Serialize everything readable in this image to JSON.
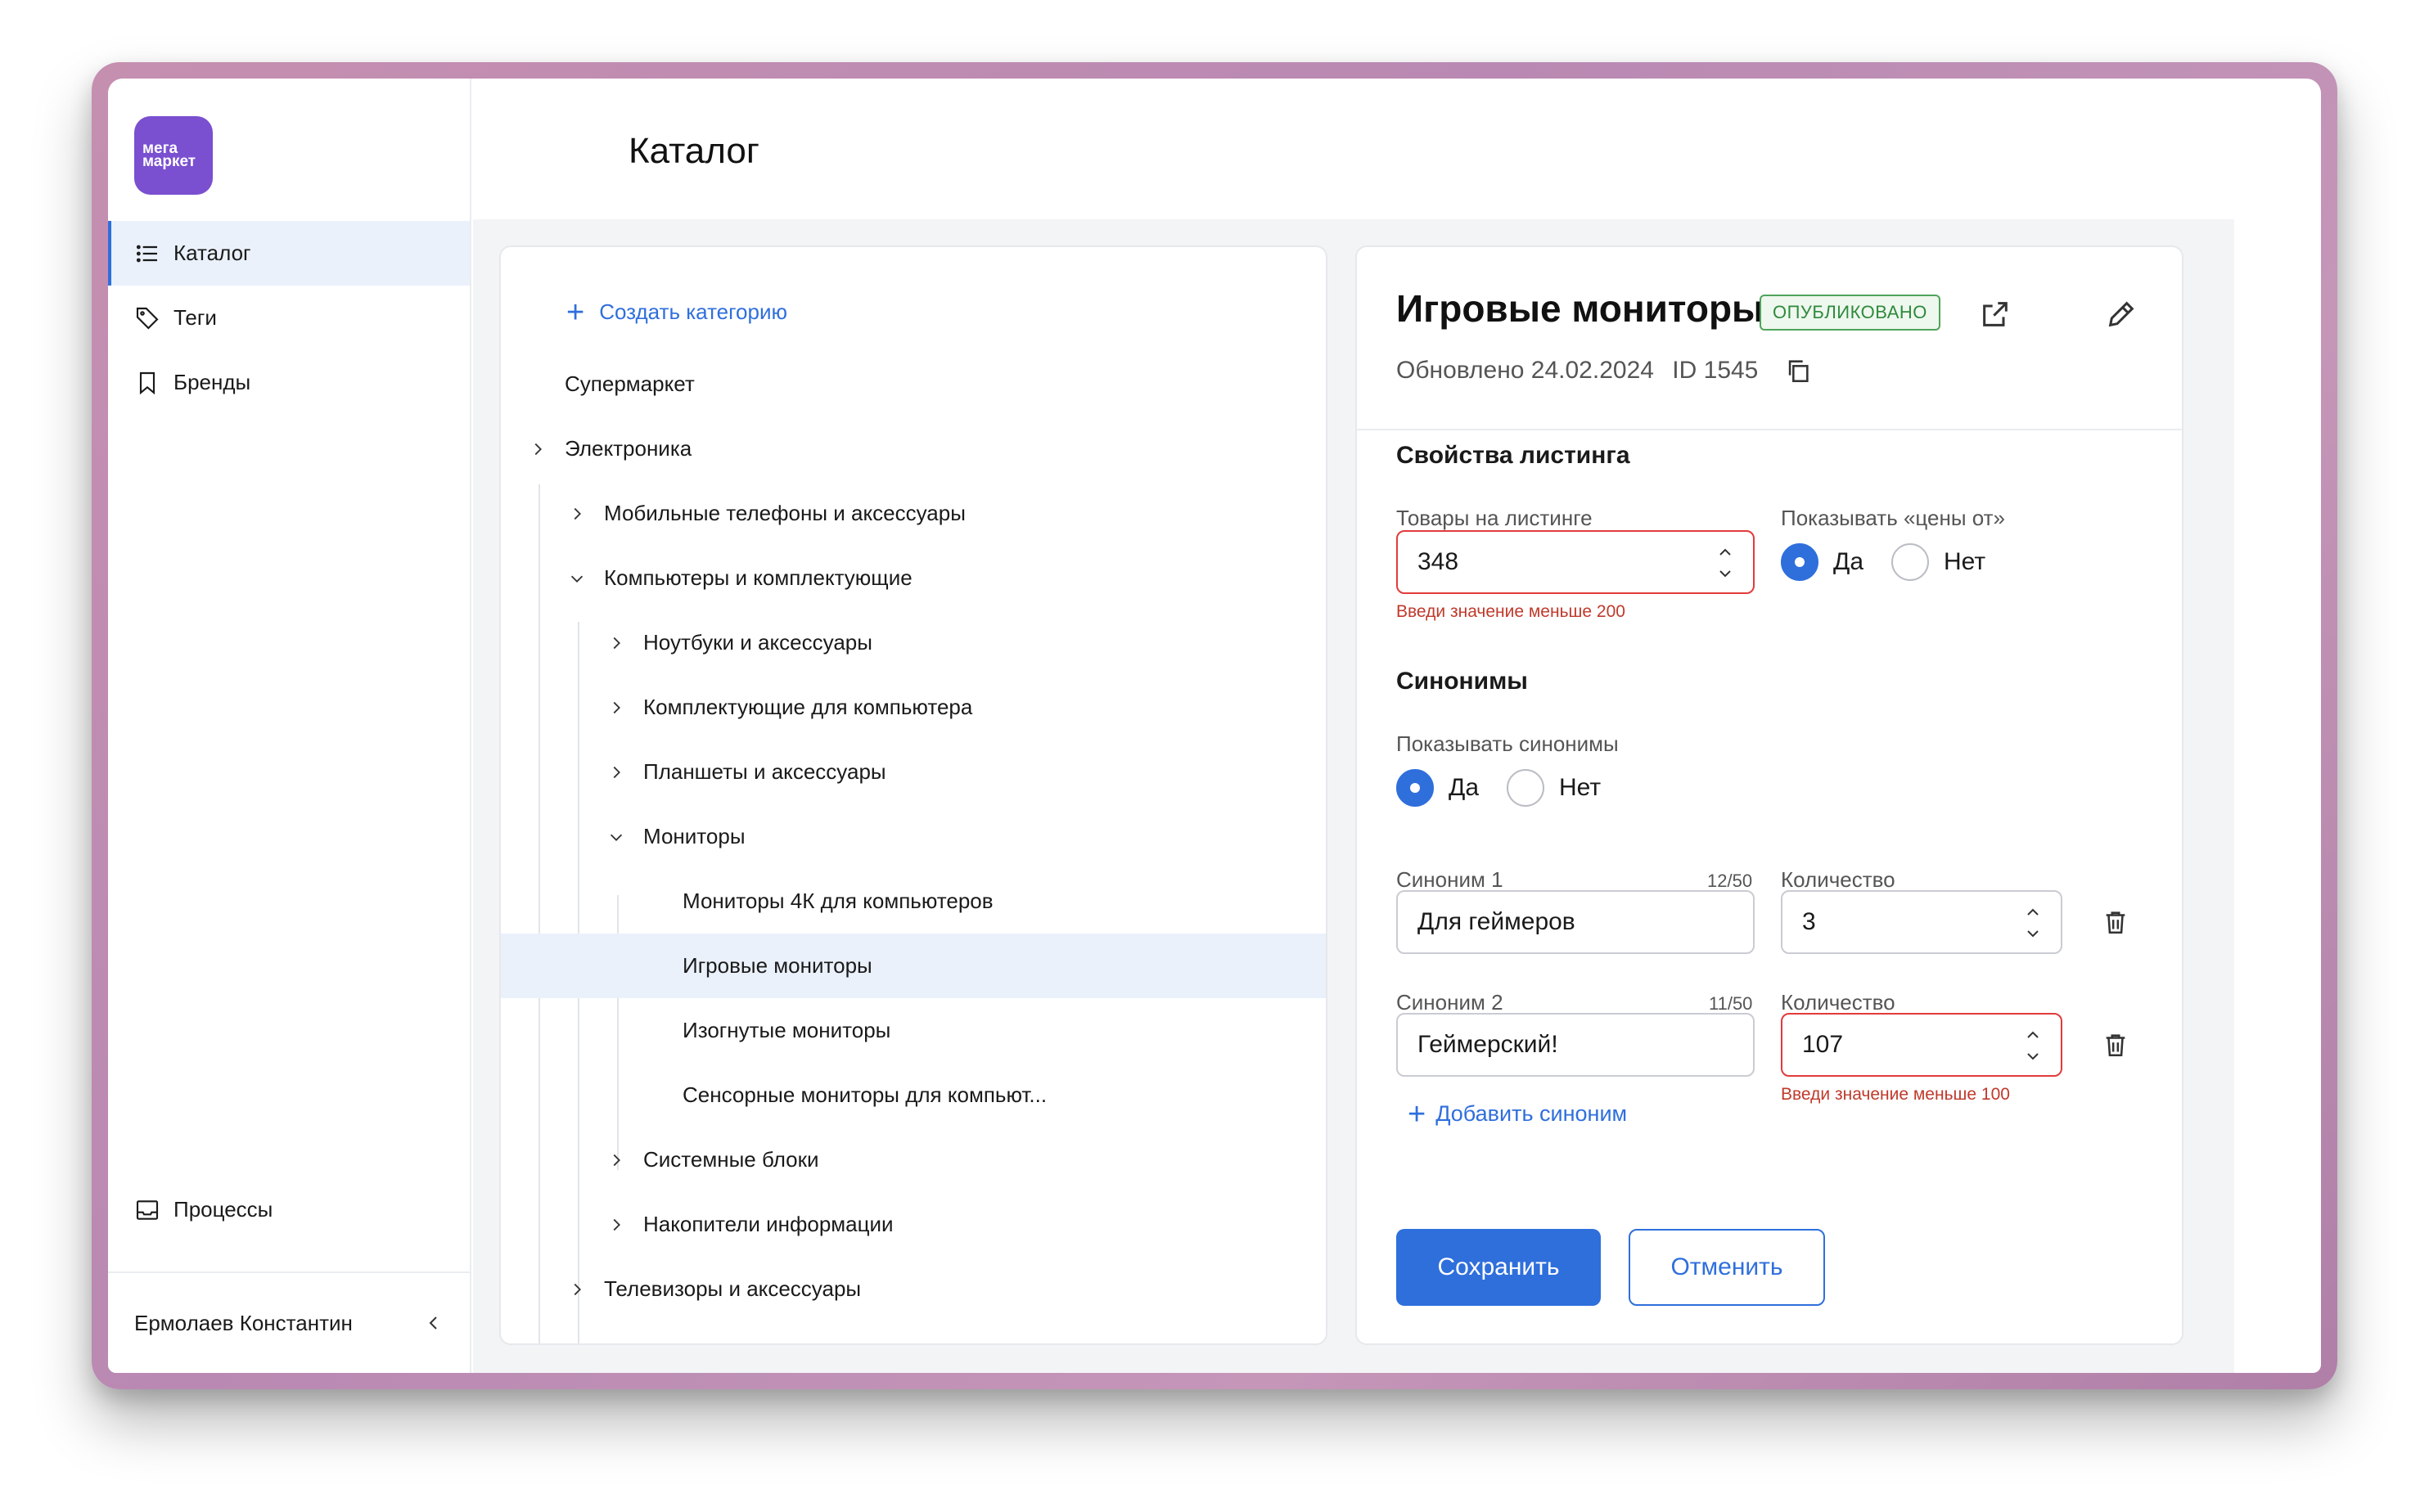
{
  "brand": {
    "logo_line1": "мега",
    "logo_line2": "маркет",
    "color": "#7a4fd0"
  },
  "sidebar": {
    "items": [
      {
        "label": "Каталог",
        "icon": "list-icon",
        "active": true
      },
      {
        "label": "Теги",
        "icon": "tag-icon"
      },
      {
        "label": "Бренды",
        "icon": "bookmark-icon"
      }
    ],
    "processes_label": "Процессы",
    "user_name": "Ермолаев Константин"
  },
  "header": {
    "title": "Каталог"
  },
  "tree": {
    "create_label": "Создать категорию",
    "rows": [
      {
        "label": "Супермаркет"
      },
      {
        "label": "Электроника"
      },
      {
        "label": "Мобильные телефоны и аксессуары"
      },
      {
        "label": "Компьютеры и комплектующие"
      },
      {
        "label": "Ноутбуки и аксессуары"
      },
      {
        "label": "Комплектующие для компьютера"
      },
      {
        "label": "Планшеты и аксессуары"
      },
      {
        "label": "Мониторы"
      },
      {
        "label": "Мониторы 4К для компьютеров"
      },
      {
        "label": "Игровые мониторы"
      },
      {
        "label": "Изогнутые мониторы"
      },
      {
        "label": "Сенсорные мониторы для компьют..."
      },
      {
        "label": "Системные блоки"
      },
      {
        "label": "Накопители информации"
      },
      {
        "label": "Телевизоры и аксессуары"
      }
    ]
  },
  "detail": {
    "title": "Игровые мониторы",
    "status": "ОПУБЛИКОВАНО",
    "updated": "Обновлено 24.02.2024",
    "id_label": "ID 1545",
    "listing": {
      "section_title": "Свойства листинга",
      "items_label": "Товары на листинге",
      "items_value": "348",
      "items_error": "Введи значение меньше 200",
      "show_price_label": "Показывать «цены от»",
      "yes": "Да",
      "no": "Нет"
    },
    "synonyms": {
      "section_title": "Синонимы",
      "show_label": "Показывать синонимы",
      "yes": "Да",
      "no": "Нет",
      "rows": [
        {
          "label": "Синоним 1",
          "counter": "12/50",
          "value": "Для геймеров",
          "qty_label": "Количество",
          "qty": "3",
          "qty_error": ""
        },
        {
          "label": "Синоним 2",
          "counter": "11/50",
          "value": "Геймерский!",
          "qty_label": "Количество",
          "qty": "107",
          "qty_error": "Введи значение меньше 100"
        }
      ],
      "add_label": "Добавить синоним"
    },
    "save_label": "Сохранить",
    "cancel_label": "Отменить"
  },
  "colors": {
    "accent": "#2f6fdc",
    "error": "#e23b3b",
    "published": "#2f8a3c"
  }
}
